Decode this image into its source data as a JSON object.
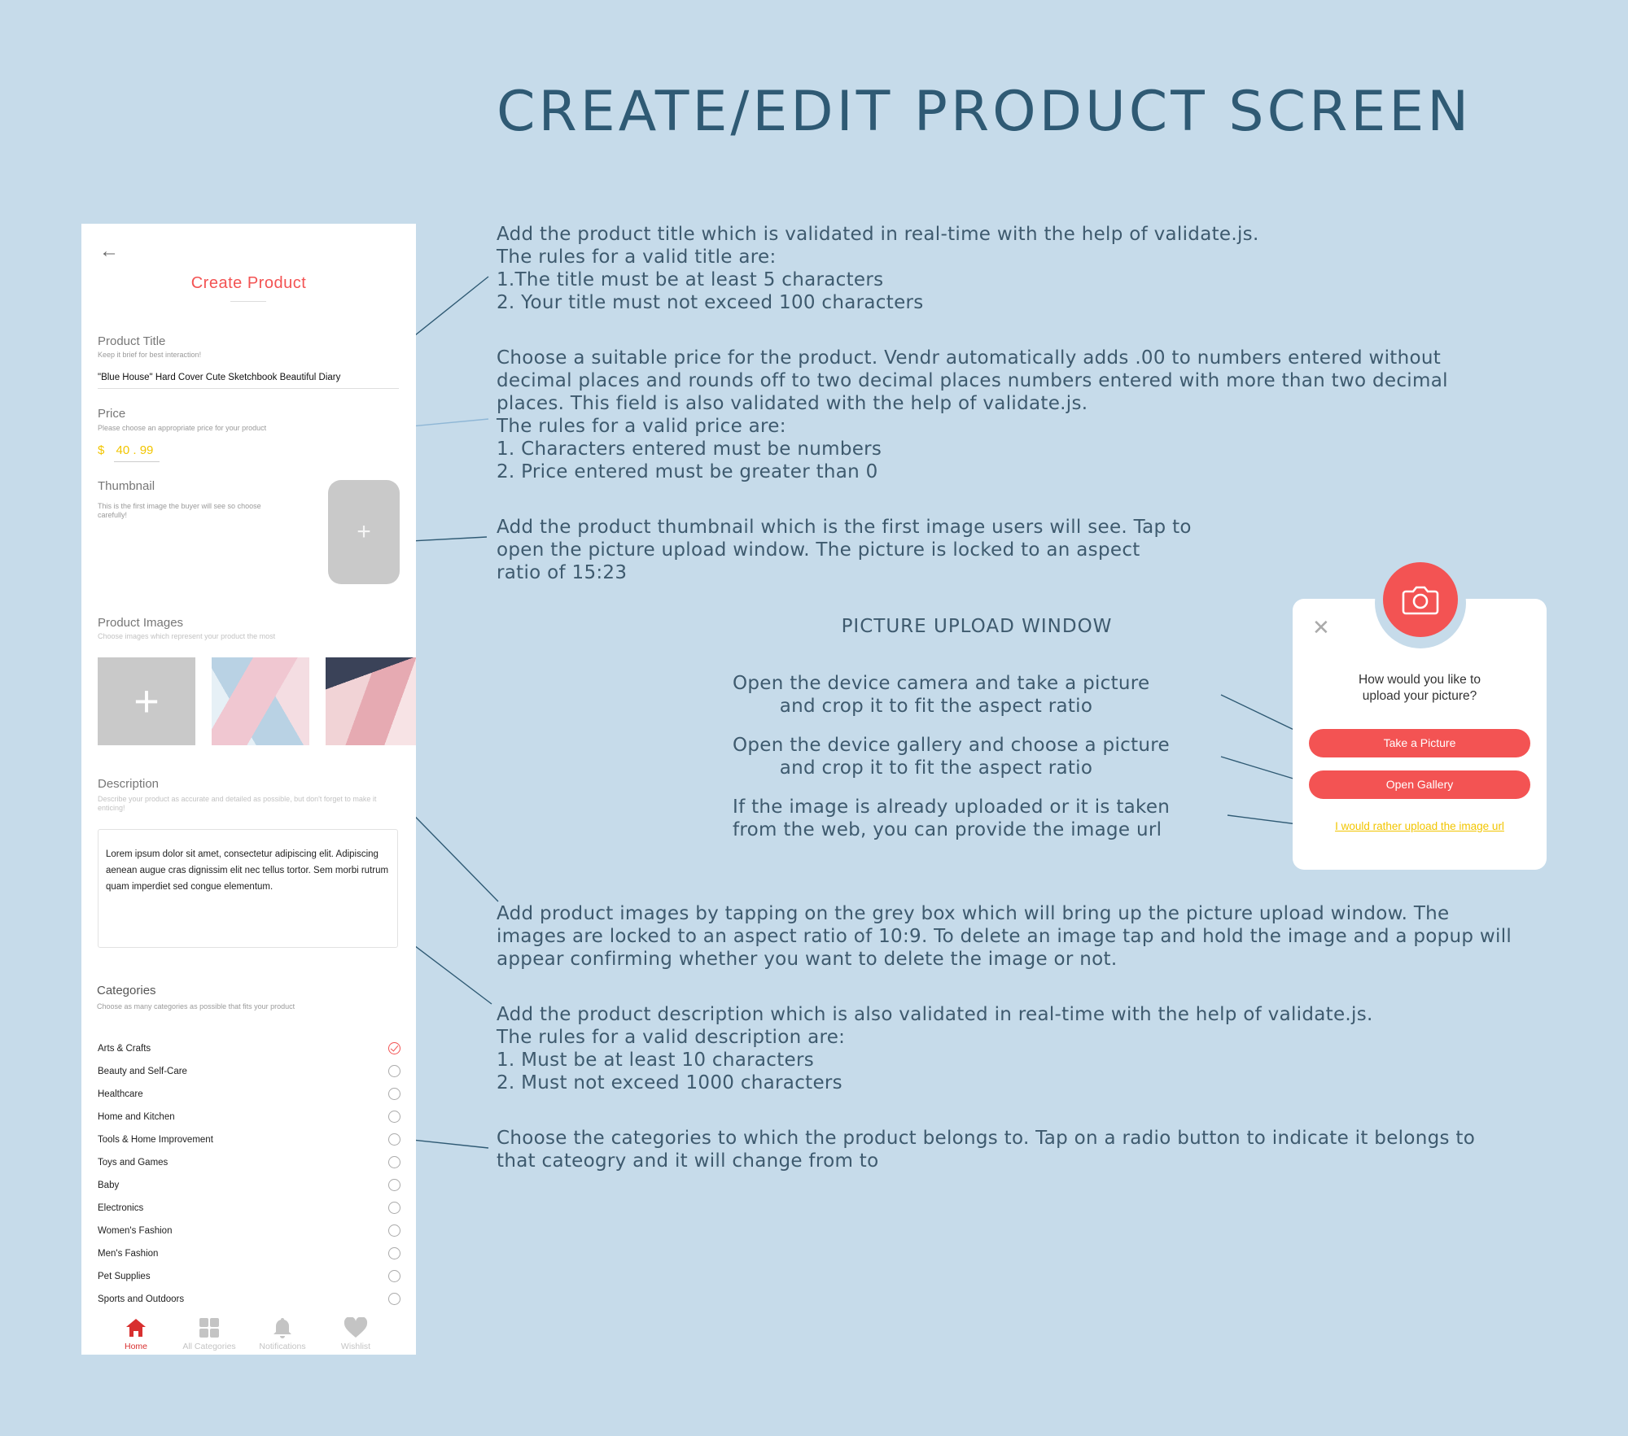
{
  "page": {
    "title": "CREATE/EDIT PRODUCT SCREEN"
  },
  "phone": {
    "screen_title": "Create Product",
    "back_icon": "arrow-left-icon",
    "product_title": {
      "label": "Product Title",
      "hint": "Keep it brief for best interaction!",
      "value": "\"Blue House\" Hard Cover Cute Sketchbook Beautiful Diary"
    },
    "price": {
      "label": "Price",
      "hint": "Please choose an appropriate price for your product",
      "currency": "$",
      "value": "40 . 99"
    },
    "thumbnail": {
      "label": "Thumbnail",
      "hint": "This is the first image the buyer will see so choose carefully!",
      "add_symbol": "+"
    },
    "product_images": {
      "label": "Product Images",
      "hint": "Choose images which represent your product the most",
      "add_symbol": "+"
    },
    "description": {
      "label": "Description",
      "hint": "Describe your product as accurate and detailed as possible, but don't forget to make it enticing!",
      "value": "Lorem ipsum dolor sit amet, consectetur adipiscing elit. Adipiscing aenean augue cras dignissim elit nec tellus tortor. Sem morbi rutrum quam imperdiet sed congue elementum."
    },
    "categories": {
      "label": "Categories",
      "hint": "Choose as many categories as possible that fits your product",
      "items": [
        {
          "name": "Arts & Crafts",
          "checked": true
        },
        {
          "name": "Beauty and Self-Care",
          "checked": false
        },
        {
          "name": "Healthcare",
          "checked": false
        },
        {
          "name": "Home and Kitchen",
          "checked": false
        },
        {
          "name": "Tools & Home Improvement",
          "checked": false
        },
        {
          "name": "Toys and Games",
          "checked": false
        },
        {
          "name": "Baby",
          "checked": false
        },
        {
          "name": "Electronics",
          "checked": false
        },
        {
          "name": "Women's Fashion",
          "checked": false
        },
        {
          "name": "Men's Fashion",
          "checked": false
        },
        {
          "name": "Pet Supplies",
          "checked": false
        },
        {
          "name": "Sports and Outdoors",
          "checked": false
        }
      ]
    },
    "nav": [
      {
        "label": "Home",
        "icon": "home-icon",
        "active": true
      },
      {
        "label": "All Categories",
        "icon": "grid-icon",
        "active": false
      },
      {
        "label": "Notifications",
        "icon": "bell-icon",
        "active": false
      },
      {
        "label": "Wishlist",
        "icon": "heart-icon",
        "active": false
      }
    ],
    "accent_color": "#f35353",
    "price_color": "#f2c500"
  },
  "notes": {
    "title": [
      "Add the product title which is validated in real-time with the help of validate.js.",
      "The rules for a valid title are:",
      "1.The title must be at least 5 characters",
      "2. Your title must not exceed 100 characters"
    ],
    "price": [
      "Choose a suitable price for the product. Vendr automatically adds .00 to numbers entered without",
      "decimal places and rounds off to two decimal places numbers entered with more than two decimal",
      "places. This field is also validated with the help of validate.js.",
      "The rules for a valid price are:",
      "1. Characters entered must be numbers",
      "2. Price entered must be greater than 0"
    ],
    "thumbnail": [
      "Add the product thumbnail which is the first image users will see. Tap to",
      "open the picture upload window. The picture is locked to an aspect",
      "ratio of 15:23"
    ],
    "images": [
      "Add product images by tapping on the grey box which will bring up the picture upload window. The",
      "images are locked to an aspect ratio of 10:9. To delete an image tap and hold the image and a popup will",
      "appear confirming whether you want to delete the image or not."
    ],
    "description": [
      "Add the product description which is also validated in real-time with the help of validate.js.",
      "The rules for a valid description are:",
      "1. Must be at least 10 characters",
      "2. Must not exceed 1000 characters"
    ],
    "categories": [
      "Choose the categories to which the product belongs to. Tap on a radio button to indicate it belongs to",
      "that cateogry and it will change from    to"
    ]
  },
  "upload_window": {
    "heading": "PICTURE UPLOAD WINDOW",
    "camera_note": [
      "Open the device camera and take a picture",
      "and crop it to fit the aspect ratio"
    ],
    "gallery_note": [
      "Open the device gallery and choose a picture",
      "and crop it to fit the aspect ratio"
    ],
    "url_note": [
      "If the image is already uploaded or it is taken",
      "from the web, you can provide the image url"
    ],
    "popup": {
      "close_icon": "close-icon",
      "camera_icon": "camera-icon",
      "question": "How would you like to upload your picture?",
      "take_picture": "Take a Picture",
      "open_gallery": "Open Gallery",
      "url_link": "I would rather upload the image url"
    }
  }
}
